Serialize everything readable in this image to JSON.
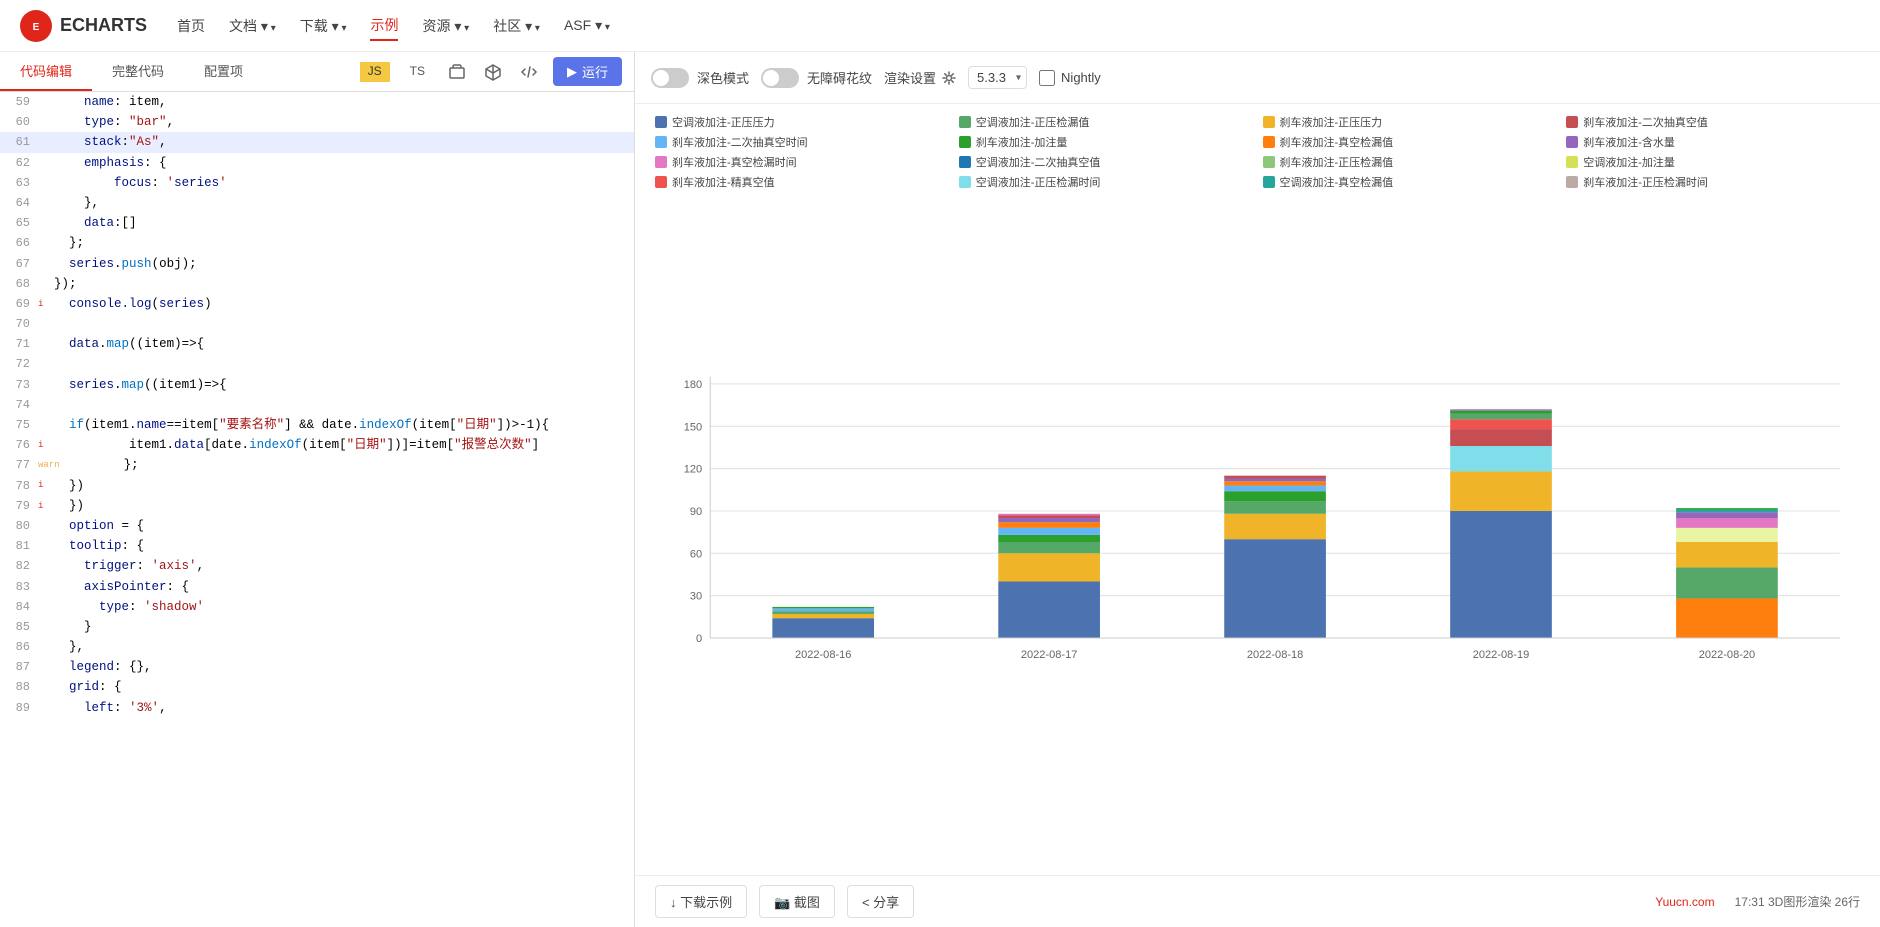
{
  "nav": {
    "logo_text": "ECHARTS",
    "items": [
      {
        "label": "首页",
        "active": false,
        "has_arrow": false
      },
      {
        "label": "文档",
        "active": false,
        "has_arrow": true
      },
      {
        "label": "下载",
        "active": false,
        "has_arrow": true
      },
      {
        "label": "示例",
        "active": true,
        "has_arrow": false
      },
      {
        "label": "资源",
        "active": false,
        "has_arrow": true
      },
      {
        "label": "社区",
        "active": false,
        "has_arrow": true
      },
      {
        "label": "ASF",
        "active": false,
        "has_arrow": true
      }
    ]
  },
  "left_panel": {
    "tabs": [
      {
        "label": "代码编辑",
        "active": true
      },
      {
        "label": "完整代码",
        "active": false
      },
      {
        "label": "配置项",
        "active": false
      }
    ],
    "js_label": "JS",
    "ts_label": "TS",
    "run_label": "▶ 运行"
  },
  "right_panel": {
    "dark_mode_label": "深色模式",
    "accessible_label": "无障碍花纹",
    "render_label": "渲染设置",
    "version": "5.3.3",
    "nightly_label": "Nightly"
  },
  "chart": {
    "legend": [
      {
        "label": "空调液加注-正压压力",
        "color": "#4c72b0"
      },
      {
        "label": "空调液加注-正压检漏值",
        "color": "#55a868"
      },
      {
        "label": "刹车液加注-正压压力",
        "color": "#f0b428"
      },
      {
        "label": "刹车液加注-二次抽真空值",
        "color": "#c44e52"
      },
      {
        "label": "刹车液加注-二次抽真空时间",
        "color": "#64b5f6"
      },
      {
        "label": "刹车液加注-加注量",
        "color": "#2ca02c"
      },
      {
        "label": "刹车液加注-真空检漏值",
        "color": "#ff7f0e"
      },
      {
        "label": "刹车液加注-含水量",
        "color": "#9467bd"
      },
      {
        "label": "刹车液加注-真空检漏时间",
        "color": "#e377c2"
      },
      {
        "label": "空调液加注-二次抽真空值",
        "color": "#1f77b4"
      },
      {
        "label": "刹车液加注-正压检漏值",
        "color": "#8cc77a"
      },
      {
        "label": "空调液加注-加注量",
        "color": "#d4e157"
      },
      {
        "label": "刹车液加注-精真空值",
        "color": "#ef5350"
      },
      {
        "label": "空调液加注-正压检漏时间",
        "color": "#80deea"
      },
      {
        "label": "空调液加注-真空检漏值",
        "color": "#26a69a"
      },
      {
        "label": "刹车液加注-正压检漏时间",
        "color": "#bcaaa4"
      }
    ],
    "y_axis": [
      0,
      30,
      60,
      90,
      120,
      150,
      180
    ],
    "x_axis": [
      "2022-08-16",
      "2022-08-17",
      "2022-08-18",
      "2022-08-19",
      "2022-08-20"
    ],
    "bars": [
      {
        "date": "2022-08-16",
        "total": 22,
        "segments": [
          {
            "color": "#4c72b0",
            "value": 14
          },
          {
            "color": "#f0b428",
            "value": 3
          },
          {
            "color": "#55a868",
            "value": 2
          },
          {
            "color": "#64b5f6",
            "value": 2
          },
          {
            "color": "#2ca02c",
            "value": 1
          }
        ]
      },
      {
        "date": "2022-08-17",
        "total": 88,
        "segments": [
          {
            "color": "#4c72b0",
            "value": 40
          },
          {
            "color": "#f0b428",
            "value": 20
          },
          {
            "color": "#55a868",
            "value": 8
          },
          {
            "color": "#2ca02c",
            "value": 5
          },
          {
            "color": "#64b5f6",
            "value": 5
          },
          {
            "color": "#ff7f0e",
            "value": 4
          },
          {
            "color": "#9467bd",
            "value": 3
          },
          {
            "color": "#c44e52",
            "value": 2
          },
          {
            "color": "#e377c2",
            "value": 1
          }
        ]
      },
      {
        "date": "2022-08-18",
        "total": 115,
        "segments": [
          {
            "color": "#4c72b0",
            "value": 70
          },
          {
            "color": "#f0b428",
            "value": 18
          },
          {
            "color": "#55a868",
            "value": 9
          },
          {
            "color": "#2ca02c",
            "value": 7
          },
          {
            "color": "#64b5f6",
            "value": 4
          },
          {
            "color": "#ff7f0e",
            "value": 3
          },
          {
            "color": "#9467bd",
            "value": 2
          },
          {
            "color": "#c44e52",
            "value": 2
          }
        ]
      },
      {
        "date": "2022-08-19",
        "total": 162,
        "segments": [
          {
            "color": "#4c72b0",
            "value": 90
          },
          {
            "color": "#f0b428",
            "value": 28
          },
          {
            "color": "#80deea",
            "value": 18
          },
          {
            "color": "#c44e52",
            "value": 12
          },
          {
            "color": "#ef5350",
            "value": 7
          },
          {
            "color": "#55a868",
            "value": 4
          },
          {
            "color": "#2ca02c",
            "value": 2
          },
          {
            "color": "#9467bd",
            "value": 1
          }
        ]
      },
      {
        "date": "2022-08-20",
        "total": 92,
        "segments": [
          {
            "color": "#ff7f0e",
            "value": 28
          },
          {
            "color": "#55a868",
            "value": 22
          },
          {
            "color": "#f0b428",
            "value": 18
          },
          {
            "color": "#e8f5a3",
            "value": 10
          },
          {
            "color": "#e377c2",
            "value": 7
          },
          {
            "color": "#9467bd",
            "value": 4
          },
          {
            "color": "#26a69a",
            "value": 2
          },
          {
            "color": "#2ca02c",
            "value": 1
          }
        ]
      }
    ]
  },
  "bottom": {
    "download_label": "↓ 下载示例",
    "screenshot_label": "📷 截图",
    "share_label": "< 分享",
    "brand_link": "Yuucn.com",
    "status": "17:31 3D图形渲染 26行"
  },
  "code_lines": [
    {
      "num": 59,
      "indent": 0,
      "text": "    name: item,",
      "indicator": ""
    },
    {
      "num": 60,
      "indent": 0,
      "text": "    type: \"bar\",",
      "indicator": ""
    },
    {
      "num": 61,
      "indent": 0,
      "text": "    stack:\"As\",",
      "indicator": "",
      "highlighted": true
    },
    {
      "num": 62,
      "indent": 0,
      "text": "    emphasis: {",
      "indicator": ""
    },
    {
      "num": 63,
      "indent": 0,
      "text": "        focus: 'series'",
      "indicator": ""
    },
    {
      "num": 64,
      "indent": 0,
      "text": "    },",
      "indicator": ""
    },
    {
      "num": 65,
      "indent": 0,
      "text": "    data:[]",
      "indicator": ""
    },
    {
      "num": 66,
      "indent": 0,
      "text": "  };",
      "indicator": ""
    },
    {
      "num": 67,
      "indent": 0,
      "text": "  series.push(obj);",
      "indicator": ""
    },
    {
      "num": 68,
      "indent": 0,
      "text": "});",
      "indicator": ""
    },
    {
      "num": 69,
      "indent": 0,
      "text": "  console.log(series)",
      "indicator": "i"
    },
    {
      "num": 70,
      "indent": 0,
      "text": "",
      "indicator": ""
    },
    {
      "num": 71,
      "indent": 0,
      "text": "  data.map((item)=>{",
      "indicator": ""
    },
    {
      "num": 72,
      "indent": 0,
      "text": "",
      "indicator": ""
    },
    {
      "num": 73,
      "indent": 0,
      "text": "  series.map((item1)=>{",
      "indicator": ""
    },
    {
      "num": 74,
      "indent": 0,
      "text": "",
      "indicator": ""
    },
    {
      "num": 75,
      "indent": 0,
      "text": "  if(item1.name==item[\"要素名称\"] && date.indexOf(item[\"日期\"])>-1){",
      "indicator": ""
    },
    {
      "num": 76,
      "indent": 0,
      "text": "          item1.data[date.indexOf(item[\"日期\"])]=item[\"报警总次数\"]",
      "indicator": "i"
    },
    {
      "num": 77,
      "indent": 0,
      "text": "        };",
      "indicator": "warn"
    },
    {
      "num": 78,
      "indent": 0,
      "text": "  })",
      "indicator": "i"
    },
    {
      "num": 79,
      "indent": 0,
      "text": "  })",
      "indicator": "i"
    },
    {
      "num": 80,
      "indent": 0,
      "text": "  option = {",
      "indicator": ""
    },
    {
      "num": 81,
      "indent": 0,
      "text": "  tooltip: {",
      "indicator": ""
    },
    {
      "num": 82,
      "indent": 0,
      "text": "    trigger: 'axis',",
      "indicator": ""
    },
    {
      "num": 83,
      "indent": 0,
      "text": "    axisPointer: {",
      "indicator": ""
    },
    {
      "num": 84,
      "indent": 0,
      "text": "      type: 'shadow'",
      "indicator": ""
    },
    {
      "num": 85,
      "indent": 0,
      "text": "    }",
      "indicator": ""
    },
    {
      "num": 86,
      "indent": 0,
      "text": "  },",
      "indicator": ""
    },
    {
      "num": 87,
      "indent": 0,
      "text": "  legend: {},",
      "indicator": ""
    },
    {
      "num": 88,
      "indent": 0,
      "text": "  grid: {",
      "indicator": ""
    },
    {
      "num": 89,
      "indent": 0,
      "text": "    left: '3%',",
      "indicator": ""
    }
  ]
}
